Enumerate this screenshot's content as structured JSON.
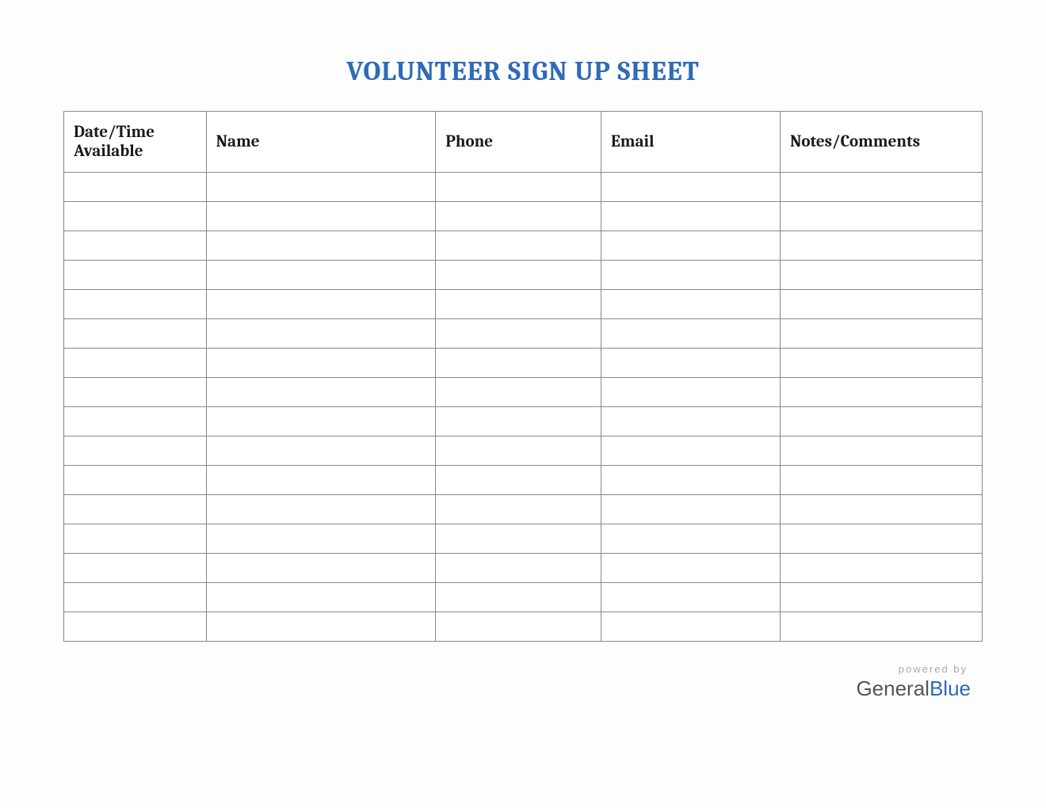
{
  "title": "VOLUNTEER SIGN UP SHEET",
  "columns": {
    "date": "Date/Time Available",
    "name": "Name",
    "phone": "Phone",
    "email": "Email",
    "notes": "Notes/Comments"
  },
  "rows": [
    {
      "date": "",
      "name": "",
      "phone": "",
      "email": "",
      "notes": ""
    },
    {
      "date": "",
      "name": "",
      "phone": "",
      "email": "",
      "notes": ""
    },
    {
      "date": "",
      "name": "",
      "phone": "",
      "email": "",
      "notes": ""
    },
    {
      "date": "",
      "name": "",
      "phone": "",
      "email": "",
      "notes": ""
    },
    {
      "date": "",
      "name": "",
      "phone": "",
      "email": "",
      "notes": ""
    },
    {
      "date": "",
      "name": "",
      "phone": "",
      "email": "",
      "notes": ""
    },
    {
      "date": "",
      "name": "",
      "phone": "",
      "email": "",
      "notes": ""
    },
    {
      "date": "",
      "name": "",
      "phone": "",
      "email": "",
      "notes": ""
    },
    {
      "date": "",
      "name": "",
      "phone": "",
      "email": "",
      "notes": ""
    },
    {
      "date": "",
      "name": "",
      "phone": "",
      "email": "",
      "notes": ""
    },
    {
      "date": "",
      "name": "",
      "phone": "",
      "email": "",
      "notes": ""
    },
    {
      "date": "",
      "name": "",
      "phone": "",
      "email": "",
      "notes": ""
    },
    {
      "date": "",
      "name": "",
      "phone": "",
      "email": "",
      "notes": ""
    },
    {
      "date": "",
      "name": "",
      "phone": "",
      "email": "",
      "notes": ""
    },
    {
      "date": "",
      "name": "",
      "phone": "",
      "email": "",
      "notes": ""
    },
    {
      "date": "",
      "name": "",
      "phone": "",
      "email": "",
      "notes": ""
    }
  ],
  "footer": {
    "powered_by": "powered by",
    "logo_part1": "General",
    "logo_part2": "Blue"
  }
}
